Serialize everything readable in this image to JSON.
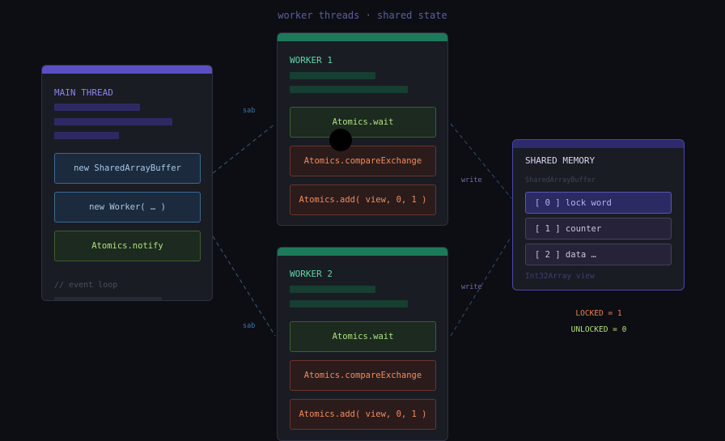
{
  "title": "worker threads · shared state",
  "colors": {
    "background": "#0d0e13",
    "main_accent": "#5b4fc4",
    "worker_accent": "#1c7a5a",
    "shared_accent": "#2d2a6e"
  },
  "main_thread": {
    "title": "MAIN THREAD",
    "buttons": {
      "shared_buffer": "new SharedArrayBuffer",
      "new_worker": "new Worker( … )",
      "notify": "Atomics.notify"
    },
    "footer": "// event loop"
  },
  "worker1": {
    "title": "WORKER 1",
    "ops": {
      "wait": "Atomics.wait",
      "cas": "Atomics.compareExchange",
      "add": "Atomics.add( view, 0, 1 )"
    }
  },
  "worker2": {
    "title": "WORKER 2",
    "ops": {
      "wait": "Atomics.wait",
      "cas": "Atomics.compareExchange",
      "add": "Atomics.add( view, 0, 1 )"
    }
  },
  "shared_memory": {
    "title": "SHARED MEMORY",
    "subtitle": "SharedArrayBuffer",
    "slots": [
      "[ 0 ] lock word",
      "[ 1 ] counter",
      "[ 2 ] data …"
    ],
    "footer": "Int32Array view"
  },
  "edges": {
    "sab_top": "sab",
    "sab_bottom": "sab",
    "write_top": "write",
    "write_bottom": "write"
  },
  "legend": {
    "locked": "LOCKED = 1",
    "unlocked": "UNLOCKED = 0"
  }
}
